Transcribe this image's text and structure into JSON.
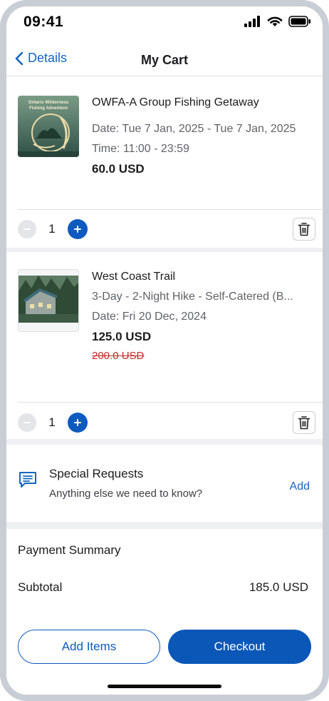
{
  "status_bar": {
    "time": "09:41",
    "icons": [
      "cellular-signal-icon",
      "wifi-icon",
      "battery-icon"
    ]
  },
  "nav": {
    "back_label": "Details",
    "title": "My Cart"
  },
  "cart_items": [
    {
      "title": "OWFA-A Group Fishing Getaway",
      "thumbnail_text": [
        "Ontario Wilderness",
        "Fishing Adventure"
      ],
      "date": "Date: Tue 7 Jan, 2025 - Tue 7 Jan, 2025",
      "time": "Time: 11:00 - 23:59",
      "price": "60.0 USD",
      "quantity": "1"
    },
    {
      "title": "West Coast Trail",
      "subtitle": "3-Day - 2-Night Hike - Self-Catered (B...",
      "date": "Date: Fri 20 Dec, 2024",
      "price": "125.0 USD",
      "original_price": "200.0 USD",
      "quantity": "1"
    }
  ],
  "special_requests": {
    "title": "Special Requests",
    "subtitle": "Anything else we need to know?",
    "action_label": "Add"
  },
  "payment_summary": {
    "title": "Payment Summary",
    "subtotal_label": "Subtotal",
    "subtotal_value": "185.0 USD"
  },
  "actions": {
    "add_items_label": "Add Items",
    "checkout_label": "Checkout"
  },
  "colors": {
    "accent": "#0b57b8",
    "link": "#1565c0",
    "strike_price": "#c62828",
    "disabled": "#e3e5e8"
  }
}
